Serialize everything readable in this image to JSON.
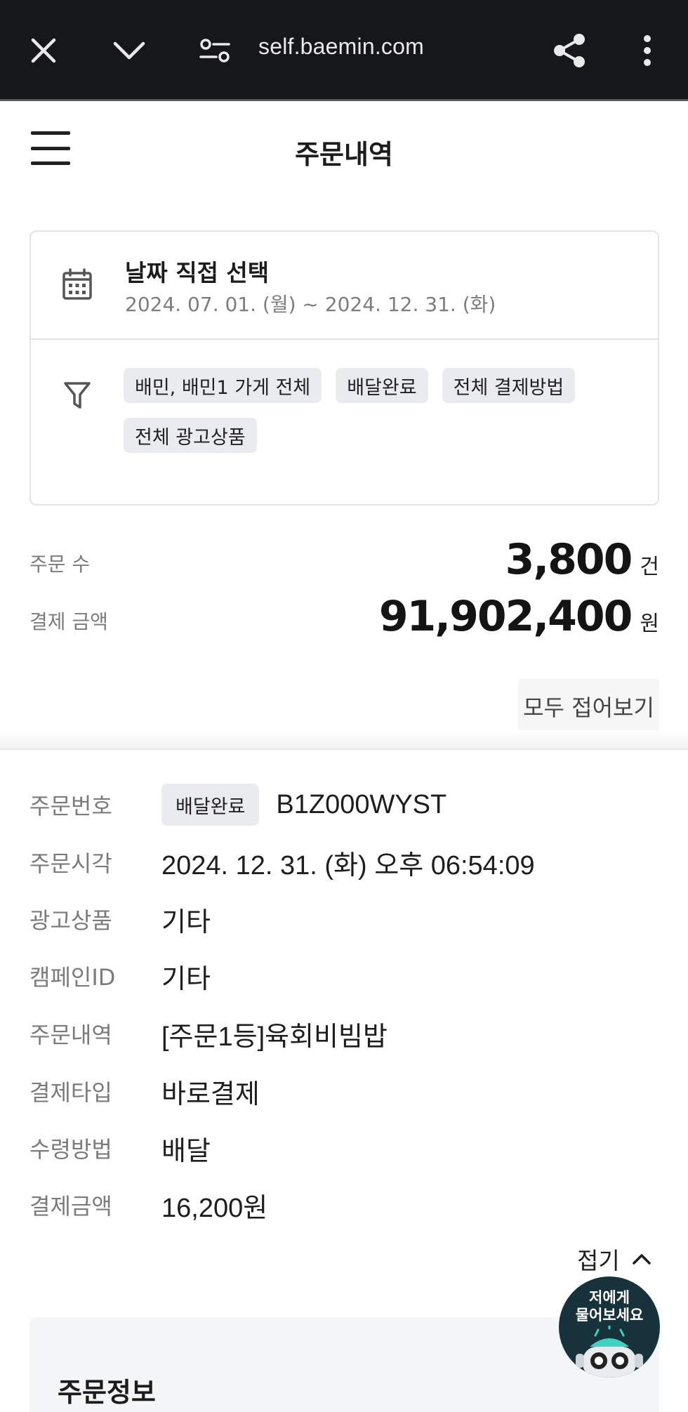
{
  "browser": {
    "url": "self.baemin.com",
    "icons": [
      "close-icon",
      "chevron-down-icon",
      "site-settings-icon",
      "share-icon",
      "more-vert-icon"
    ]
  },
  "header": {
    "title": "주문내역"
  },
  "filters": {
    "date_title": "날짜 직접 선택",
    "date_range": "2024. 07. 01. (월) ~ 2024. 12. 31. (화)",
    "chips": [
      "배민, 배민1 가게 전체",
      "배달완료",
      "전체 결제방법",
      "전체 광고상품"
    ]
  },
  "summary": {
    "order_count_label": "주문 수",
    "order_count_value": "3,800",
    "order_count_unit": "건",
    "payment_label": "결제 금액",
    "payment_value": "91,902,400",
    "payment_unit": "원",
    "collapse_all_label": "모두 접어보기"
  },
  "order": {
    "labels": {
      "order_number": "주문번호",
      "order_time": "주문시각",
      "ad_product": "광고상품",
      "campaign_id": "캠페인ID",
      "order_details": "주문내역",
      "payment_type": "결제타입",
      "receive_method": "수령방법",
      "payment_amount": "결제금액"
    },
    "status": "배달완료",
    "order_number": "B1Z000WYST",
    "order_time": "2024. 12. 31. (화) 오후 06:54:09",
    "ad_product": "기타",
    "campaign_id": "기타",
    "order_details": "[주문1등]육회비빔밥",
    "payment_type": "바로결제",
    "receive_method": "배달",
    "payment_amount": "16,200원",
    "fold_label": "접기"
  },
  "order_info": {
    "title": "주문정보"
  },
  "chatbot": {
    "line1": "저에게",
    "line2": "물어보세요"
  },
  "colors": {
    "browser_bar": "#16171b",
    "chip_bg": "#e9ebee",
    "label_gray": "#7b7b7b",
    "chatbot_bg": "#17323a",
    "chatbot_accent": "#3fd1c2"
  }
}
